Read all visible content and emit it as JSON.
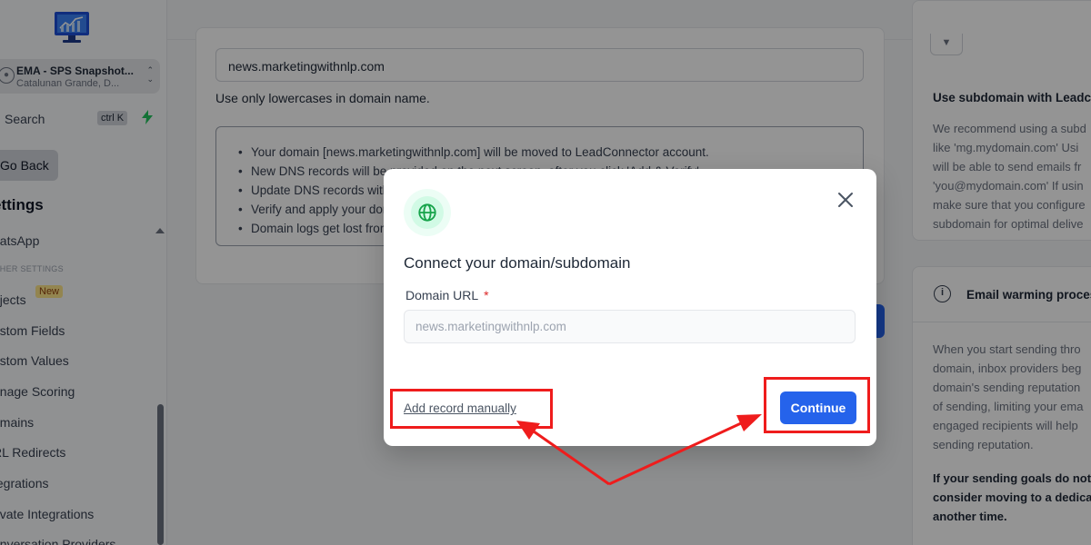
{
  "sidebar": {
    "account": {
      "name": "EMA - SPS Snapshot...",
      "location": "Catalunan Grande, D..."
    },
    "search": {
      "label": "Search",
      "shortcut": "ctrl K"
    },
    "go_back": "Go Back",
    "settings_title": "ettings",
    "section_label": "THER SETTINGS",
    "new_badge": "New",
    "items": [
      {
        "label": "hatsApp"
      },
      {
        "label": "bjects"
      },
      {
        "label": "ustom Fields"
      },
      {
        "label": "ustom Values"
      },
      {
        "label": "anage Scoring"
      },
      {
        "label": "omains"
      },
      {
        "label": "RL Redirects"
      },
      {
        "label": "tegrations"
      },
      {
        "label": "rivate Integrations"
      },
      {
        "label": "onversation Providers"
      }
    ]
  },
  "main": {
    "domain_value": "news.marketingwithnlp.com",
    "hint": "Use only lowercases in domain name.",
    "bullets": [
      "Your domain [news.marketingwithnlp.com] will be moved to LeadConnector account.",
      "New DNS records will be provided on the next screen, after you click 'Add & Verify'.",
      "Update DNS records with",
      "Verify and apply your dor",
      "Domain logs get lost from"
    ]
  },
  "right_panel": {
    "card1_title": "Use subdomain with Leadco",
    "card1_body": [
      "We recommend using a subd",
      "like 'mg.mydomain.com' Usi",
      "will be able to send emails fr",
      "'you@mydomain.com' If usin",
      "make sure that you configure",
      "subdomain for optimal delive"
    ],
    "card2_title": "Email warming proces",
    "card2_body": [
      "When you start sending thro",
      "domain, inbox providers beg",
      "domain's sending reputation",
      "of sending, limiting your ema",
      "engaged recipients will help",
      "sending reputation."
    ],
    "card2_bold": [
      "If your sending goals do not",
      "consider moving to a dedica",
      "another time."
    ]
  },
  "modal": {
    "title": "Connect your domain/subdomain",
    "field_label": "Domain URL",
    "required_mark": "*",
    "placeholder": "news.marketingwithnlp.com",
    "add_manually": "Add record manually",
    "continue": "Continue"
  },
  "colors": {
    "primary": "#2563eb",
    "annotation": "#ef1c1c",
    "globe": "#16a34a"
  },
  "icons": [
    "logo-icon",
    "building-icon",
    "chevron-updown-icon",
    "bolt-icon",
    "caret-up-icon",
    "globe-icon",
    "close-icon",
    "info-icon",
    "filter-icon"
  ]
}
